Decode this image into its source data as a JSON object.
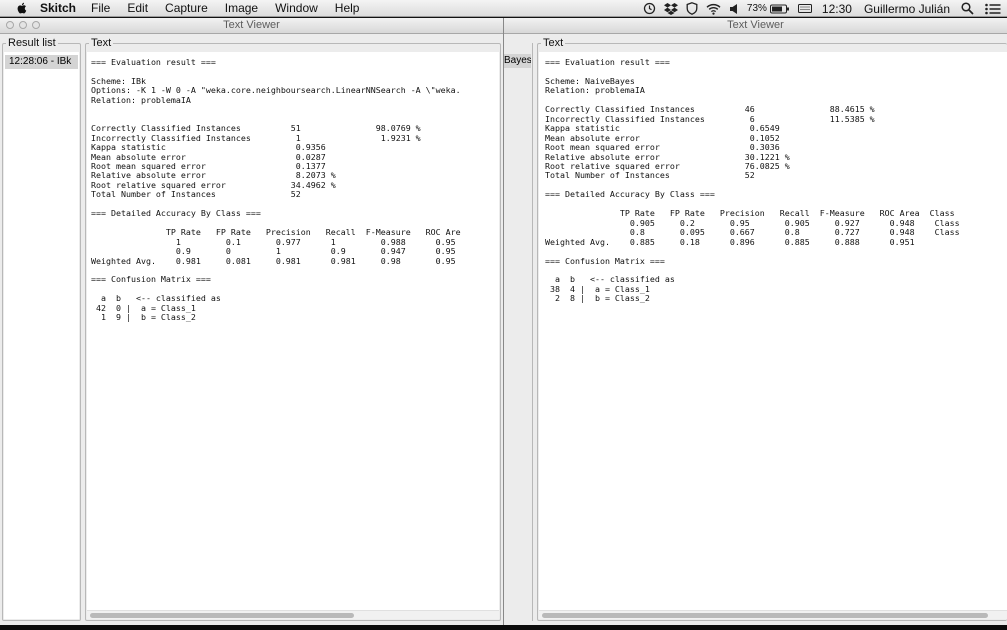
{
  "menubar": {
    "app_name": "Skitch",
    "items": [
      "File",
      "Edit",
      "Capture",
      "Image",
      "Window",
      "Help"
    ],
    "status": {
      "battery": "73%",
      "time": "12:30",
      "user": "Guillermo Julián"
    }
  },
  "left_window": {
    "title": "Text Viewer",
    "result_list_label": "Result list",
    "result_item": "12:28:06 - IBk",
    "text_label": "Text",
    "output": "=== Evaluation result ===\n\nScheme: IBk\nOptions: -K 1 -W 0 -A \"weka.core.neighboursearch.LinearNNSearch -A \\\"weka.\nRelation: problemaIA\n\n\nCorrectly Classified Instances          51               98.0769 %\nIncorrectly Classified Instances         1                1.9231 %\nKappa statistic                          0.9356\nMean absolute error                      0.0287\nRoot mean squared error                  0.1377\nRelative absolute error                  8.2073 %\nRoot relative squared error             34.4962 %\nTotal Number of Instances               52\n\n=== Detailed Accuracy By Class ===\n\n               TP Rate   FP Rate   Precision   Recall  F-Measure   ROC Are\n                 1         0.1       0.977      1         0.988      0.95\n                 0.9       0         1          0.9       0.947      0.95\nWeighted Avg.    0.981     0.081     0.981      0.981     0.98       0.95\n\n=== Confusion Matrix ===\n\n  a  b   <-- classified as\n 42  0 |  a = Class_1\n  1  9 |  b = Class_2"
  },
  "right_window": {
    "title": "Text Viewer",
    "peek_label": "Bayes",
    "text_label": "Text",
    "output": "=== Evaluation result ===\n\nScheme: NaiveBayes\nRelation: problemaIA\n\nCorrectly Classified Instances          46               88.4615 %\nIncorrectly Classified Instances         6               11.5385 %\nKappa statistic                          0.6549\nMean absolute error                      0.1052\nRoot mean squared error                  0.3036\nRelative absolute error                 30.1221 %\nRoot relative squared error             76.0825 %\nTotal Number of Instances               52\n\n=== Detailed Accuracy By Class ===\n\n               TP Rate   FP Rate   Precision   Recall  F-Measure   ROC Area  Class\n                 0.905     0.2       0.95       0.905     0.927      0.948    Class\n                 0.8       0.095     0.667      0.8       0.727      0.948    Class\nWeighted Avg.    0.885     0.18      0.896      0.885     0.888      0.951\n\n=== Confusion Matrix ===\n\n  a  b   <-- classified as\n 38  4 |  a = Class_1\n  2  8 |  b = Class_2"
  }
}
